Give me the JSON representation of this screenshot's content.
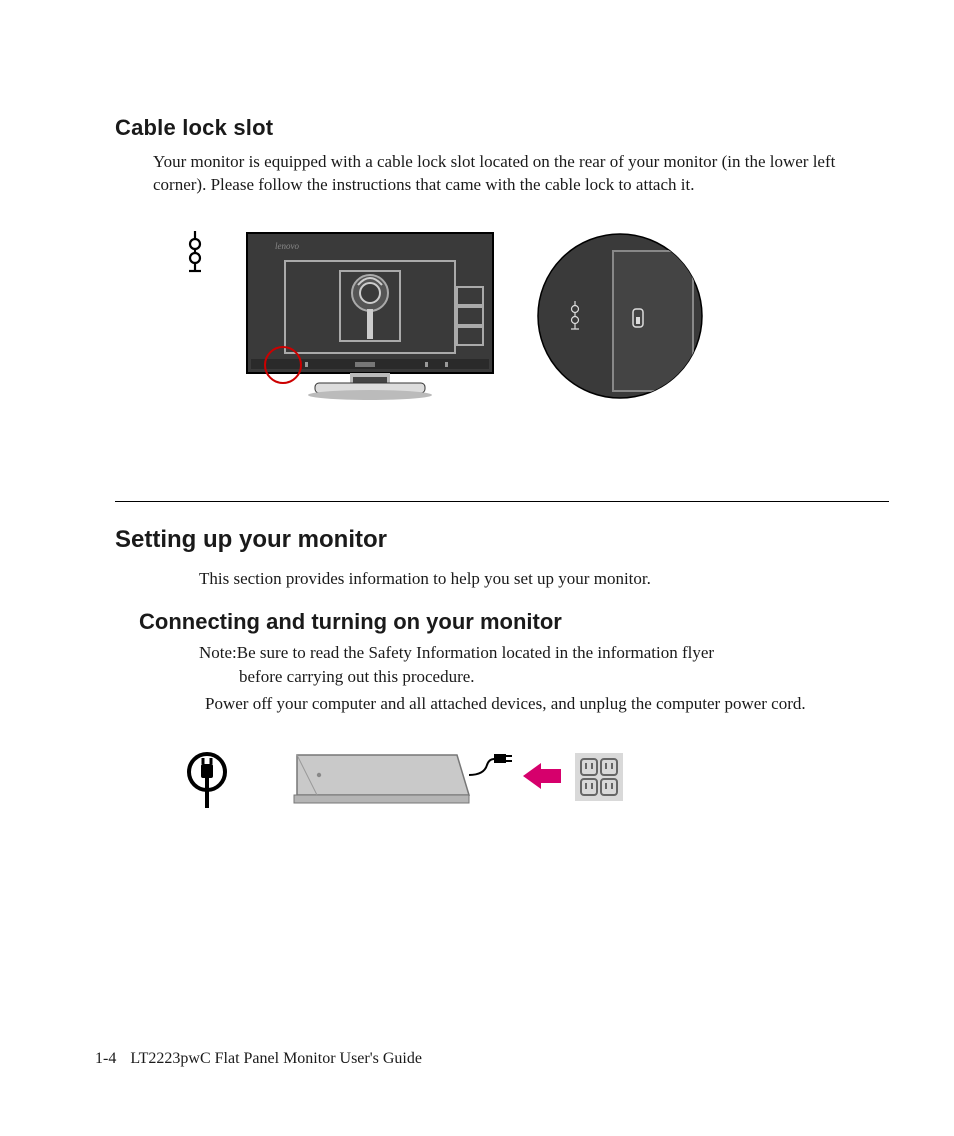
{
  "section1": {
    "heading": "Cable lock slot",
    "body": "Your monitor is equipped with a cable lock slot located on the rear of your monitor (in the lower left corner). Please follow the instructions that came with the cable lock to attach it."
  },
  "section2": {
    "heading": "Setting up your monitor",
    "intro": "This section provides information to help you set up your monitor."
  },
  "section3": {
    "heading": "Connecting and turning on your monitor",
    "note_label": "Note:",
    "note_line1": "Be sure to read the Safety Information located in the information flyer",
    "note_line2": "before carrying out this procedure.",
    "power_text": "Power off your computer and all attached devices, and unplug the computer power cord."
  },
  "footer": {
    "page_number": "1-4",
    "title": "LT2223pwC Flat Panel Monitor User's Guide"
  }
}
